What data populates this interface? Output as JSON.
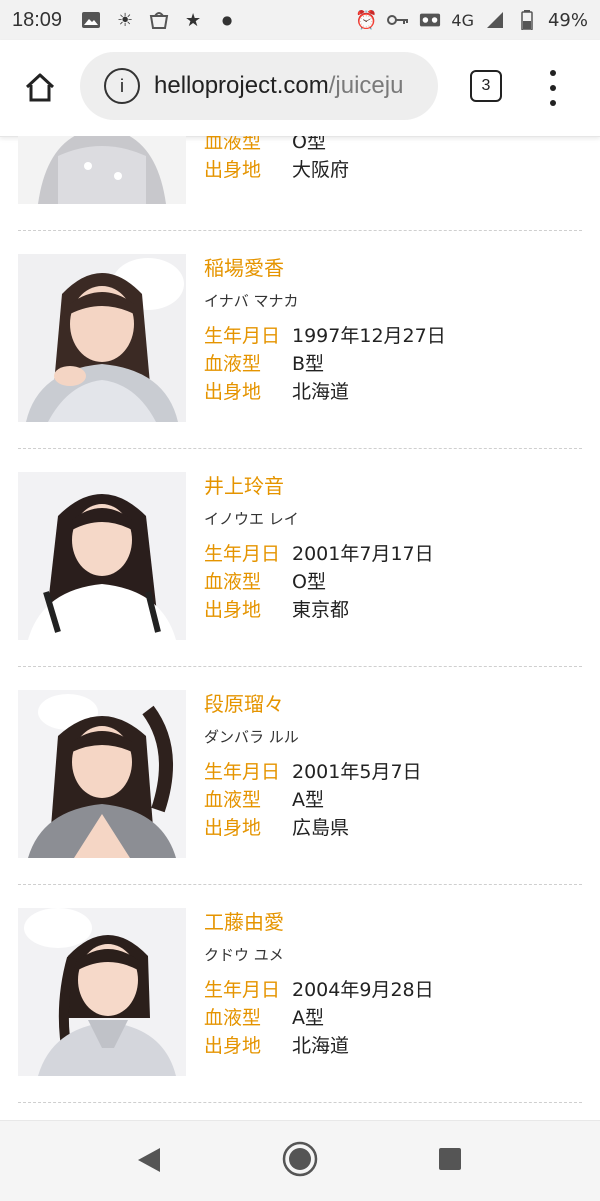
{
  "status": {
    "time": "18:09",
    "network": "4G",
    "battery": "49%",
    "icons_left": [
      "image-icon",
      "weather-icon",
      "mosaic-icon",
      "star-icon",
      "dot-icon"
    ],
    "icons_right": [
      "alarm-icon",
      "key-icon",
      "voicemail-icon",
      "signal-icon",
      "battery-icon"
    ]
  },
  "browser": {
    "url_host": "helloproject.com",
    "url_path": "/juiceju",
    "tab_count": "3"
  },
  "labels": {
    "birth": "生年月日",
    "blood": "血液型",
    "hometown": "出身地"
  },
  "partial": {
    "blood": "O型",
    "hometown": "大阪府"
  },
  "members": [
    {
      "name": "稲場愛香",
      "kana": "イナバ マナカ",
      "birth": "1997年12月27日",
      "blood": "B型",
      "hometown": "北海道"
    },
    {
      "name": "井上玲音",
      "kana": "イノウエ レイ",
      "birth": "2001年7月17日",
      "blood": "O型",
      "hometown": "東京都"
    },
    {
      "name": "段原瑠々",
      "kana": "ダンバラ ルル",
      "birth": "2001年5月7日",
      "blood": "A型",
      "hometown": "広島県"
    },
    {
      "name": "工藤由愛",
      "kana": "クドウ ユメ",
      "birth": "2004年9月28日",
      "blood": "A型",
      "hometown": "北海道"
    }
  ]
}
